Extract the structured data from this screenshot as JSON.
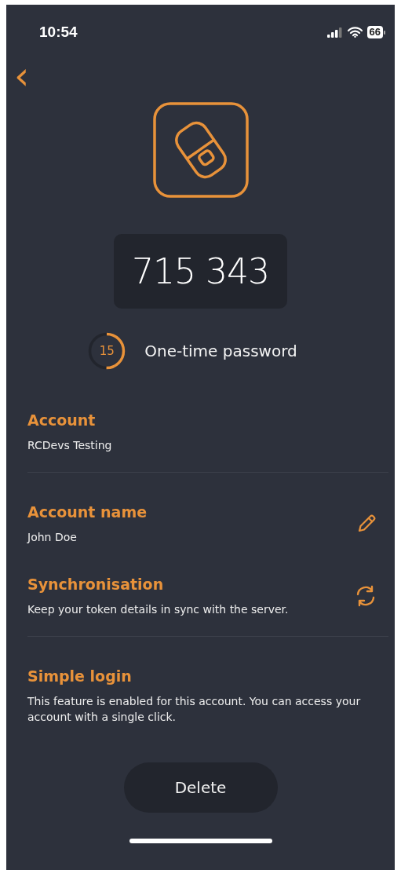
{
  "status_bar": {
    "time": "10:54",
    "battery": "66"
  },
  "back_button": {
    "icon": "‹"
  },
  "token": {
    "code": "715 343",
    "timer": {
      "seconds": "15",
      "level": 0.5
    },
    "label": "One-time password"
  },
  "sections": [
    {
      "title": "Account",
      "text": "RCDevs Testing",
      "kind": "plain",
      "divider": true
    },
    {
      "title": "Account name",
      "text": "John Doe",
      "kind": "edit",
      "divider": false
    },
    {
      "title": "Synchronisation",
      "text": "Keep your token details in sync with the server.",
      "kind": "sync",
      "divider": true
    },
    {
      "title": "Simple login",
      "text": "This feature is enabled for this account. You can access your account with a single click.",
      "kind": "plain",
      "divider": false
    }
  ],
  "delete_button": {
    "label": "Delete"
  }
}
